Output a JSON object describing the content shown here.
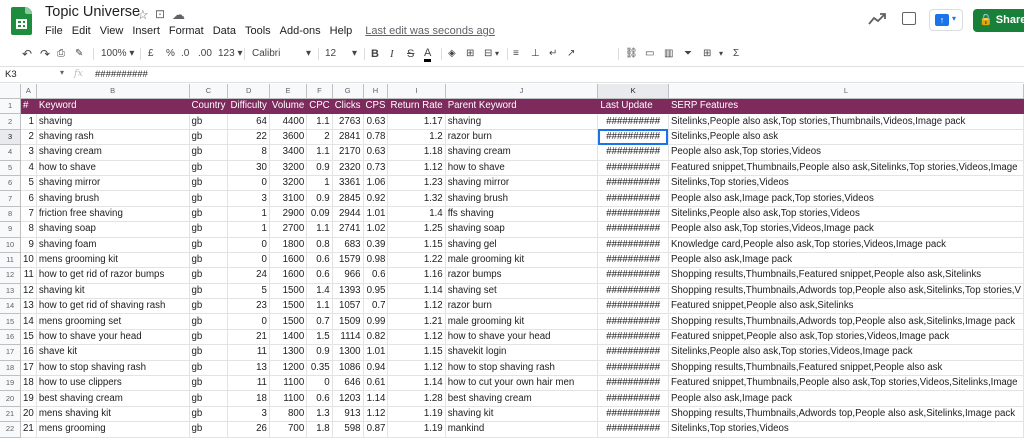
{
  "doc": {
    "title": "Topic Universe",
    "last_edit": "Last edit was seconds ago",
    "share_label": "Share"
  },
  "menu": [
    "File",
    "Edit",
    "View",
    "Insert",
    "Format",
    "Data",
    "Tools",
    "Add-ons",
    "Help"
  ],
  "toolbar": {
    "zoom": "100%",
    "currency": "£",
    "percent": "%",
    "dec_less": ".0",
    "dec_more": ".00",
    "number_format": "123",
    "font": "Calibri",
    "font_size": "12",
    "bold": "B",
    "italic": "I",
    "strike": "S",
    "text_color": "A"
  },
  "formula_bar": {
    "cell_ref": "K3",
    "fx": "fx",
    "value": "##########"
  },
  "columns": [
    "A",
    "B",
    "C",
    "D",
    "E",
    "F",
    "G",
    "H",
    "I",
    "J",
    "K",
    "L"
  ],
  "selected": {
    "row": 3,
    "col": "K"
  },
  "header": [
    "#",
    "Keyword",
    "Country",
    "Difficulty",
    "Volume",
    "CPC",
    "Clicks",
    "CPS",
    "Return Rate",
    "Parent Keyword",
    "Last Update",
    "SERP Features"
  ],
  "rows": [
    [
      "1",
      "shaving",
      "gb",
      "64",
      "4400",
      "1.1",
      "2763",
      "0.63",
      "1.17",
      "shaving",
      "##########",
      "Sitelinks,People also ask,Top stories,Thumbnails,Videos,Image pack"
    ],
    [
      "2",
      "shaving rash",
      "gb",
      "22",
      "3600",
      "2",
      "2841",
      "0.78",
      "1.2",
      "razor burn",
      "##########",
      "Sitelinks,People also ask"
    ],
    [
      "3",
      "shaving cream",
      "gb",
      "8",
      "3400",
      "1.1",
      "2170",
      "0.63",
      "1.18",
      "shaving cream",
      "##########",
      "People also ask,Top stories,Videos"
    ],
    [
      "4",
      "how to shave",
      "gb",
      "30",
      "3200",
      "0.9",
      "2320",
      "0.73",
      "1.12",
      "how to shave",
      "##########",
      "Featured snippet,Thumbnails,People also ask,Sitelinks,Top stories,Videos,Image"
    ],
    [
      "5",
      "shaving mirror",
      "gb",
      "0",
      "3200",
      "1",
      "3361",
      "1.06",
      "1.23",
      "shaving mirror",
      "##########",
      "Sitelinks,Top stories,Videos"
    ],
    [
      "6",
      "shaving brush",
      "gb",
      "3",
      "3100",
      "0.9",
      "2845",
      "0.92",
      "1.32",
      "shaving brush",
      "##########",
      "People also ask,Image pack,Top stories,Videos"
    ],
    [
      "7",
      "friction free shaving",
      "gb",
      "1",
      "2900",
      "0.09",
      "2944",
      "1.01",
      "1.4",
      "ffs shaving",
      "##########",
      "Sitelinks,People also ask,Top stories,Videos"
    ],
    [
      "8",
      "shaving soap",
      "gb",
      "1",
      "2700",
      "1.1",
      "2741",
      "1.02",
      "1.25",
      "shaving soap",
      "##########",
      "People also ask,Top stories,Videos,Image pack"
    ],
    [
      "9",
      "shaving foam",
      "gb",
      "0",
      "1800",
      "0.8",
      "683",
      "0.39",
      "1.15",
      "shaving gel",
      "##########",
      "Knowledge card,People also ask,Top stories,Videos,Image pack"
    ],
    [
      "10",
      "mens grooming kit",
      "gb",
      "0",
      "1600",
      "0.6",
      "1579",
      "0.98",
      "1.22",
      "male grooming kit",
      "##########",
      "People also ask,Image pack"
    ],
    [
      "11",
      "how to get rid of razor bumps",
      "gb",
      "24",
      "1600",
      "0.6",
      "966",
      "0.6",
      "1.16",
      "razor bumps",
      "##########",
      "Shopping results,Thumbnails,Featured snippet,People also ask,Sitelinks"
    ],
    [
      "12",
      "shaving kit",
      "gb",
      "5",
      "1500",
      "1.4",
      "1393",
      "0.95",
      "1.14",
      "shaving set",
      "##########",
      "Shopping results,Thumbnails,Adwords top,People also ask,Sitelinks,Top stories,V"
    ],
    [
      "13",
      "how to get rid of shaving rash",
      "gb",
      "23",
      "1500",
      "1.1",
      "1057",
      "0.7",
      "1.12",
      "razor burn",
      "##########",
      "Featured snippet,People also ask,Sitelinks"
    ],
    [
      "14",
      "mens grooming set",
      "gb",
      "0",
      "1500",
      "0.7",
      "1509",
      "0.99",
      "1.21",
      "male grooming kit",
      "##########",
      "Shopping results,Thumbnails,Adwords top,People also ask,Sitelinks,Image pack"
    ],
    [
      "15",
      "how to shave your head",
      "gb",
      "21",
      "1400",
      "1.5",
      "1114",
      "0.82",
      "1.12",
      "how to shave your head",
      "##########",
      "Featured snippet,People also ask,Top stories,Videos,Image pack"
    ],
    [
      "16",
      "shave kit",
      "gb",
      "11",
      "1300",
      "0.9",
      "1300",
      "1.01",
      "1.15",
      "shavekit login",
      "##########",
      "Sitelinks,People also ask,Top stories,Videos,Image pack"
    ],
    [
      "17",
      "how to stop shaving rash",
      "gb",
      "13",
      "1200",
      "0.35",
      "1086",
      "0.94",
      "1.12",
      "how to stop shaving rash",
      "##########",
      "Shopping results,Thumbnails,Featured snippet,People also ask"
    ],
    [
      "18",
      "how to use clippers",
      "gb",
      "11",
      "1100",
      "0",
      "646",
      "0.61",
      "1.14",
      "how to cut your own hair men",
      "##########",
      "Featured snippet,Thumbnails,People also ask,Top stories,Videos,Sitelinks,Image"
    ],
    [
      "19",
      "best shaving cream",
      "gb",
      "18",
      "1100",
      "0.6",
      "1203",
      "1.14",
      "1.28",
      "best shaving cream",
      "##########",
      "People also ask,Image pack"
    ],
    [
      "20",
      "mens shaving kit",
      "gb",
      "3",
      "800",
      "1.3",
      "913",
      "1.12",
      "1.19",
      "shaving kit",
      "##########",
      "Shopping results,Thumbnails,Adwords top,People also ask,Sitelinks,Image pack"
    ],
    [
      "21",
      "mens grooming",
      "gb",
      "26",
      "700",
      "1.8",
      "598",
      "0.87",
      "1.19",
      "mankind",
      "##########",
      "Sitelinks,Top stories,Videos"
    ]
  ],
  "colors": {
    "header_bg": "#7d2a5c",
    "share_bg": "#188038",
    "selection": "#1a73e8"
  }
}
